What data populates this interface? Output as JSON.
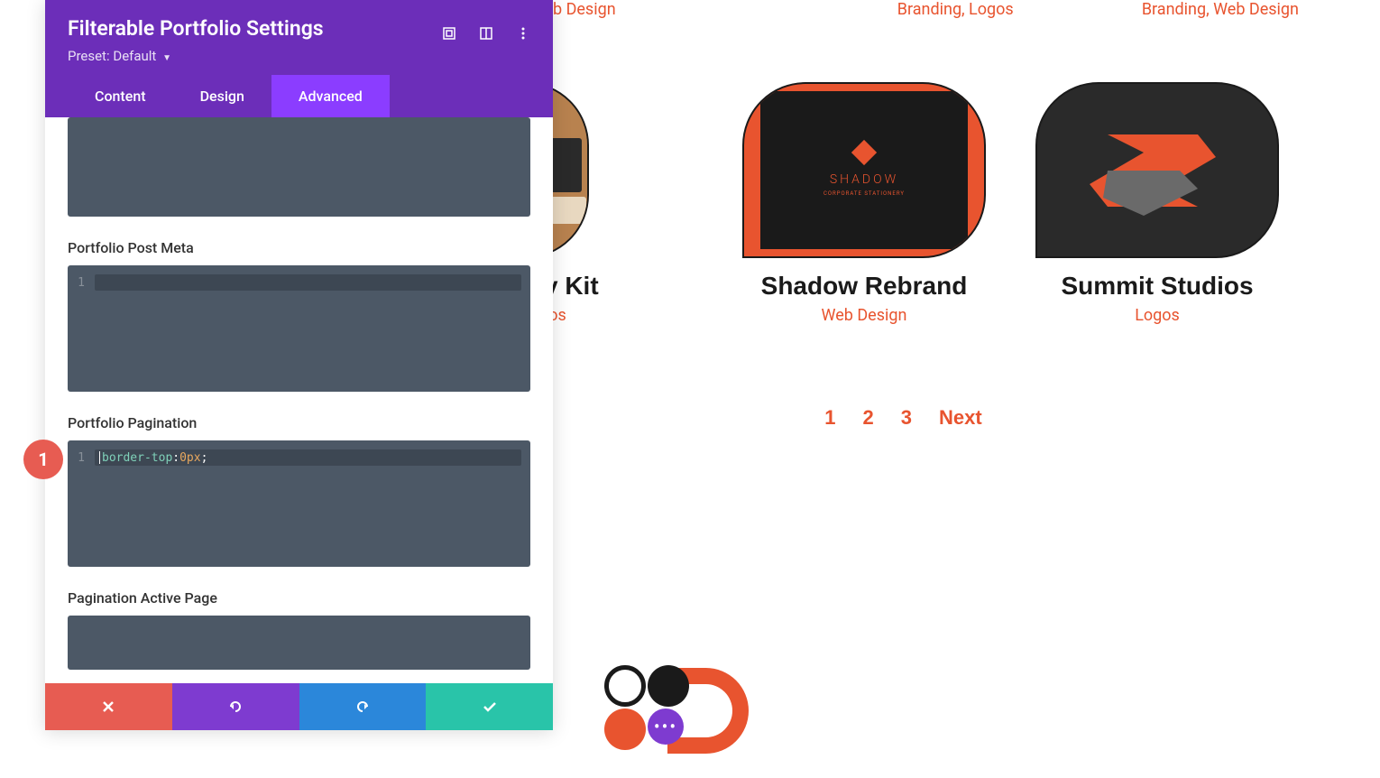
{
  "panel": {
    "title": "Filterable Portfolio Settings",
    "preset_label": "Preset:",
    "preset_value": "Default",
    "tabs": {
      "content": "Content",
      "design": "Design",
      "advanced": "Advanced"
    },
    "sections": {
      "post_meta": "Portfolio Post Meta",
      "pagination": "Portfolio Pagination",
      "active_page": "Pagination Active Page"
    },
    "code": {
      "line_number": "1",
      "property": "border-top",
      "value": "0px",
      "punct_colon": ": ",
      "punct_semi": ";"
    }
  },
  "callout": {
    "number": "1"
  },
  "top_categories": {
    "cat1": "b Design",
    "cat2": "Branding, Logos",
    "cat3": "Branding, Web Design"
  },
  "portfolio": {
    "item1": {
      "title": "onary Kit",
      "category": "Logos"
    },
    "item2": {
      "title": "Shadow Rebrand",
      "category": "Web Design",
      "logo_text": "SHADOW",
      "logo_sub": "CORPORATE STATIONERY"
    },
    "item3": {
      "title": "Summit Studios",
      "category": "Logos"
    }
  },
  "pagination": {
    "p1": "1",
    "p2": "2",
    "p3": "3",
    "next": "Next"
  },
  "footer_logo": {
    "dots": "•••"
  }
}
